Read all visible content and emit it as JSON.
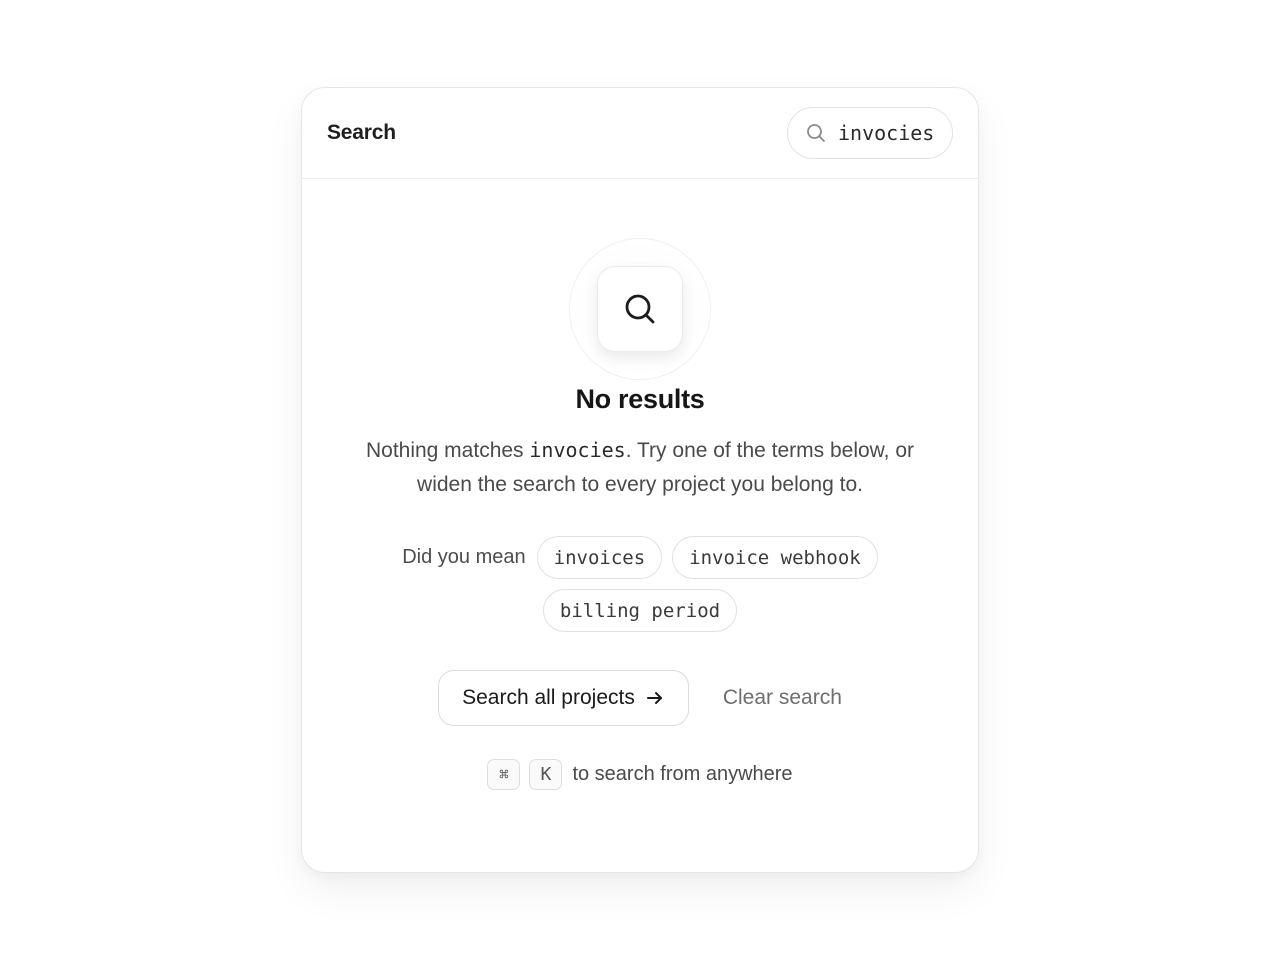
{
  "header": {
    "title": "Search",
    "search_value": "invocies",
    "search_icon": "search-icon"
  },
  "empty_state": {
    "icon": "search-icon",
    "title": "No results",
    "desc_prefix": "Nothing matches ",
    "desc_query": "invocies",
    "desc_suffix": ". Try one of the terms below, or widen the search to every project you belong to."
  },
  "suggestions": {
    "label": "Did you mean",
    "items": [
      "invoices",
      "invoice webhook",
      "billing period"
    ]
  },
  "actions": {
    "primary_label": "Search all projects",
    "primary_icon": "arrow-right-icon",
    "secondary_label": "Clear search"
  },
  "shortcut": {
    "key1": "⌘",
    "key2": "K",
    "text": "to search from anywhere"
  }
}
